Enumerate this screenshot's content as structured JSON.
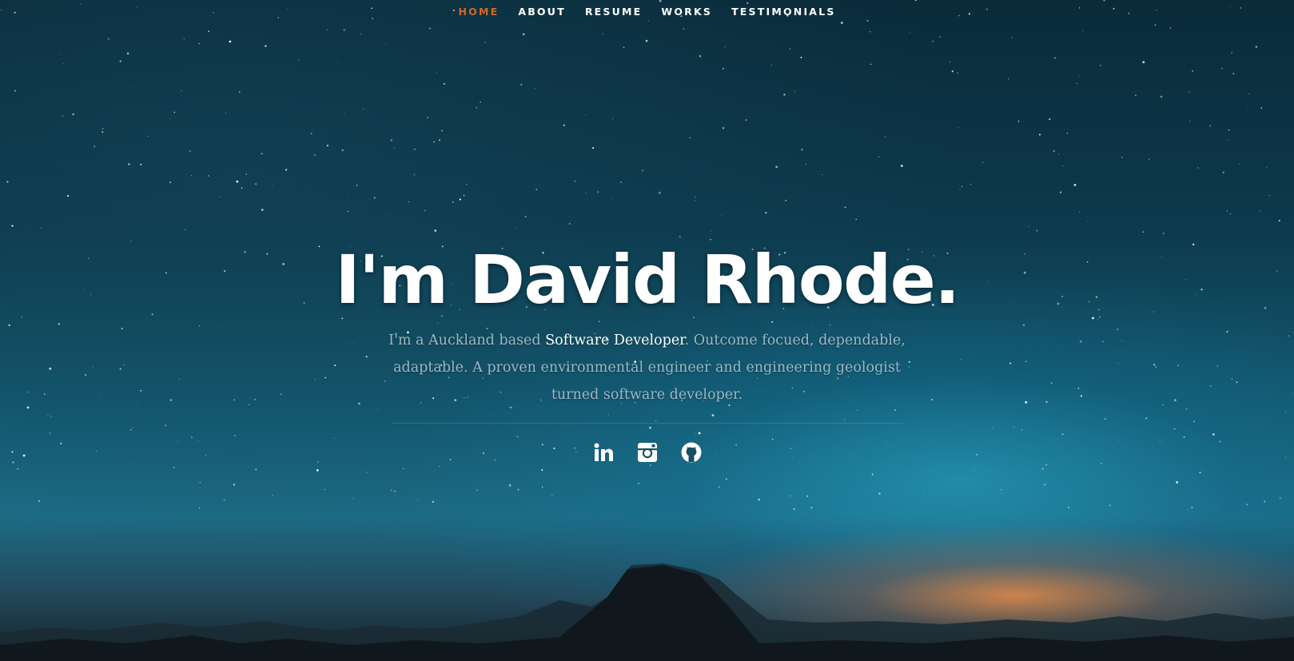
{
  "nav": {
    "items": [
      {
        "label": "Home",
        "active": true
      },
      {
        "label": "About",
        "active": false
      },
      {
        "label": "Resume",
        "active": false
      },
      {
        "label": "Works",
        "active": false
      },
      {
        "label": "Testimonials",
        "active": false
      }
    ],
    "active_color": "#d2691e"
  },
  "banner": {
    "headline": "I'm David Rhode.",
    "intro_prefix": "I'm a Auckland based ",
    "intro_highlight": "Software Developer",
    "intro_suffix": ". Outcome focued, dependable, adaptable. A proven environmental engineer and engineering geologist turned software developer."
  },
  "social": [
    {
      "name": "linkedin",
      "icon": "linkedin-icon"
    },
    {
      "name": "instagram",
      "icon": "instagram-icon"
    },
    {
      "name": "github",
      "icon": "github-icon"
    }
  ]
}
